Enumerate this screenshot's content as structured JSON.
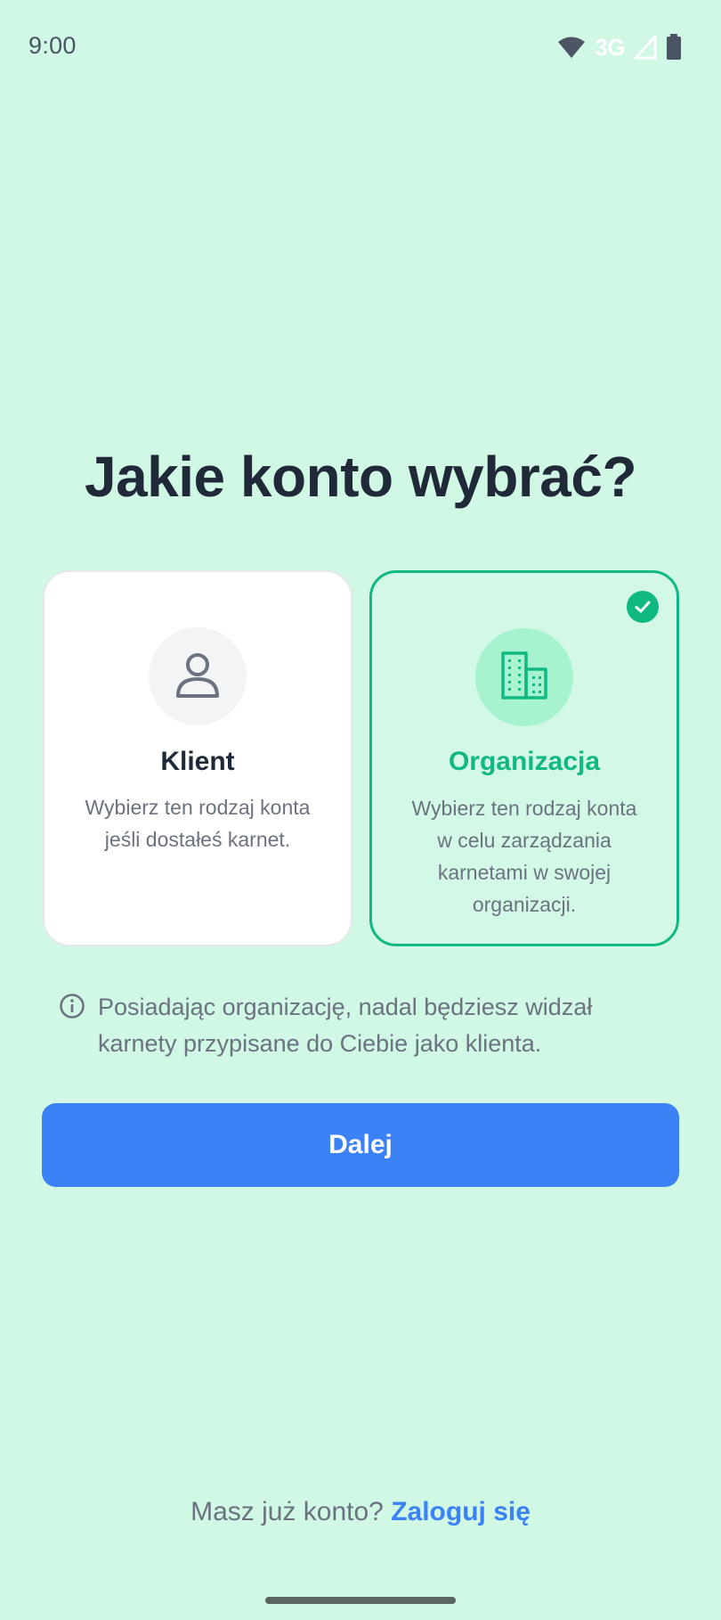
{
  "status_bar": {
    "time": "9:00",
    "network": "3G",
    "icons": [
      "wifi-icon",
      "cellular-signal-icon",
      "battery-icon"
    ]
  },
  "title": "Jakie konto wybrać?",
  "account_types": [
    {
      "icon": "user-icon",
      "title": "Klient",
      "description": "Wybierz ten rodzaj konta jeśli dostałeś karnet.",
      "selected": false
    },
    {
      "icon": "building-icon",
      "title": "Organizacja",
      "description": "Wybierz ten rodzaj konta w celu zarządzania karnetami w swojej organizacji.",
      "selected": true
    }
  ],
  "info": {
    "icon": "info-icon",
    "text": "Posiadając organizację, nadal będziesz widzał karnety przypisane do Ciebie jako klienta."
  },
  "next_button": "Dalej",
  "login": {
    "prompt": "Masz już konto?",
    "link": "Zaloguj się"
  },
  "colors": {
    "background": "#d1f7e5",
    "accent_green": "#10b981",
    "primary_blue": "#3b82f6",
    "text_dark": "#1f2937",
    "text_muted": "#6b7280"
  }
}
